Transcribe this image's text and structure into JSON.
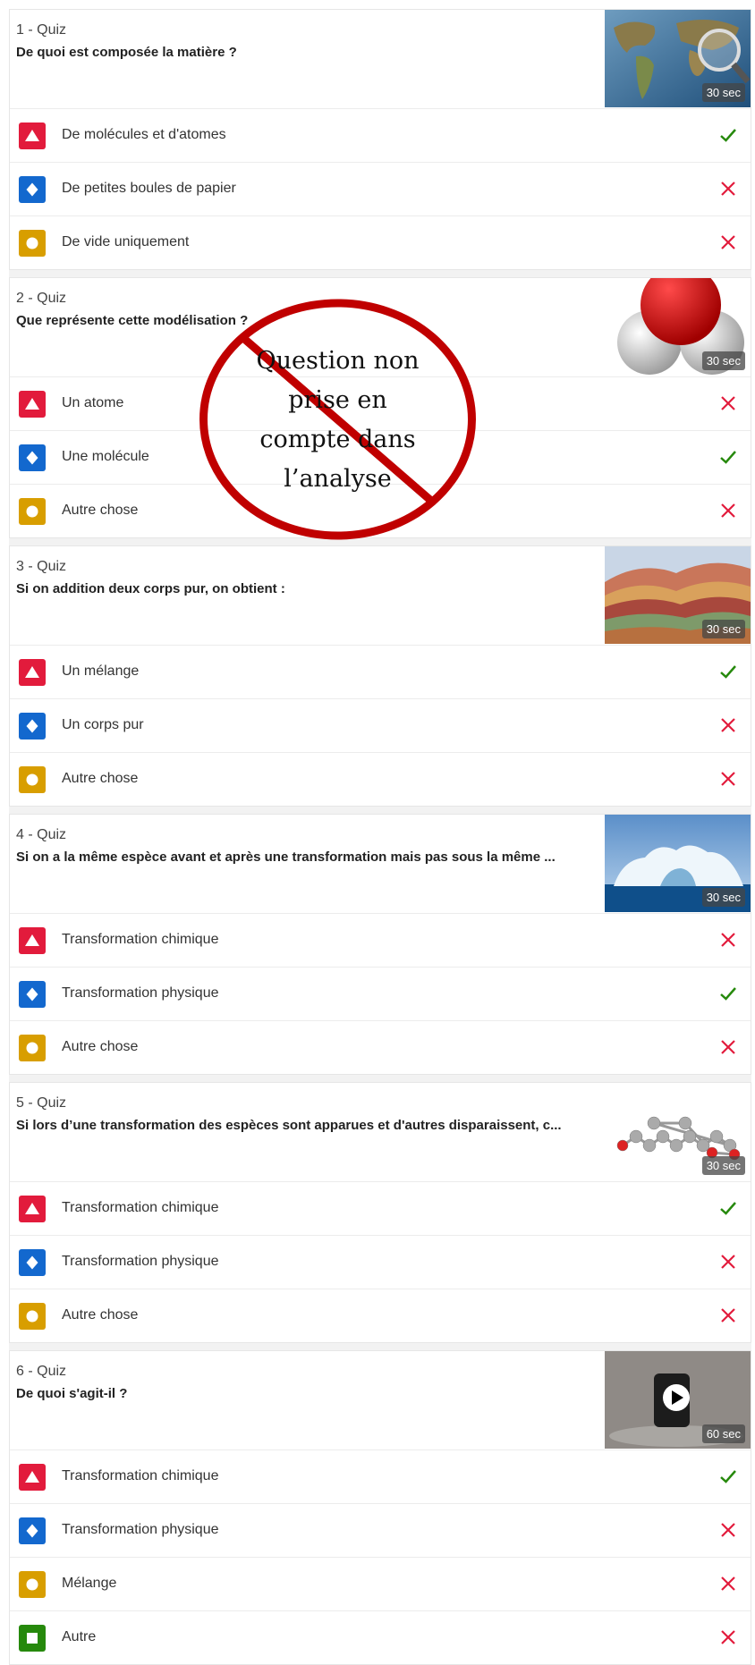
{
  "quizzes": [
    {
      "number": "1 - Quiz",
      "question": "De quoi est composée la matière ?",
      "duration": "30 sec",
      "thumbnail": "world-map-magnifier",
      "answers": [
        {
          "shape": "triangle",
          "text": "De molécules et d'atomes",
          "correct": true
        },
        {
          "shape": "diamond",
          "text": "De petites boules de papier",
          "correct": false
        },
        {
          "shape": "circle",
          "text": "De vide uniquement",
          "correct": false
        }
      ]
    },
    {
      "number": "2 - Quiz",
      "question": "Que représente cette modélisation ?",
      "duration": "30 sec",
      "thumbnail": "water-molecule-model",
      "answers": [
        {
          "shape": "triangle",
          "text": "Un atome",
          "correct": false
        },
        {
          "shape": "diamond",
          "text": "Une molécule",
          "correct": true
        },
        {
          "shape": "circle",
          "text": "Autre chose",
          "correct": false
        }
      ]
    },
    {
      "number": "3 - Quiz",
      "question": "Si on addition deux corps pur, on obtient :",
      "duration": "30 sec",
      "thumbnail": "rainbow-mountains",
      "answers": [
        {
          "shape": "triangle",
          "text": "Un mélange",
          "correct": true
        },
        {
          "shape": "diamond",
          "text": "Un corps pur",
          "correct": false
        },
        {
          "shape": "circle",
          "text": "Autre chose",
          "correct": false
        }
      ]
    },
    {
      "number": "4 - Quiz",
      "question": "Si on a la même espèce avant et après une transformation mais pas sous la même ...",
      "duration": "30 sec",
      "thumbnail": "iceberg",
      "answers": [
        {
          "shape": "triangle",
          "text": "Transformation chimique",
          "correct": false
        },
        {
          "shape": "diamond",
          "text": "Transformation physique",
          "correct": true
        },
        {
          "shape": "circle",
          "text": "Autre chose",
          "correct": false
        }
      ]
    },
    {
      "number": "5 - Quiz",
      "question": "Si lors d’une transformation des espèces sont apparues et d'autres disparaissent, c...",
      "duration": "30 sec",
      "thumbnail": "molecule-ball-stick",
      "answers": [
        {
          "shape": "triangle",
          "text": "Transformation chimique",
          "correct": true
        },
        {
          "shape": "diamond",
          "text": "Transformation physique",
          "correct": false
        },
        {
          "shape": "circle",
          "text": "Autre chose",
          "correct": false
        }
      ]
    },
    {
      "number": "6 - Quiz",
      "question": "De quoi s'agit-il ?",
      "duration": "60 sec",
      "thumbnail": "video-black-substance",
      "video": true,
      "answers": [
        {
          "shape": "triangle",
          "text": "Transformation chimique",
          "correct": true
        },
        {
          "shape": "diamond",
          "text": "Transformation physique",
          "correct": false
        },
        {
          "shape": "circle",
          "text": "Mélange",
          "correct": false
        },
        {
          "shape": "square",
          "text": "Autre",
          "correct": false
        }
      ]
    }
  ],
  "overlay": {
    "lines": [
      "Question non",
      "prise en",
      "compte dans",
      "l’analyse"
    ]
  },
  "colors": {
    "triangle": "#e21b3c",
    "diamond": "#1368ce",
    "circle": "#d89e00",
    "square": "#26890c",
    "correct": "#26890c",
    "wrong": "#e21b3c",
    "overlay": "#c00000"
  }
}
